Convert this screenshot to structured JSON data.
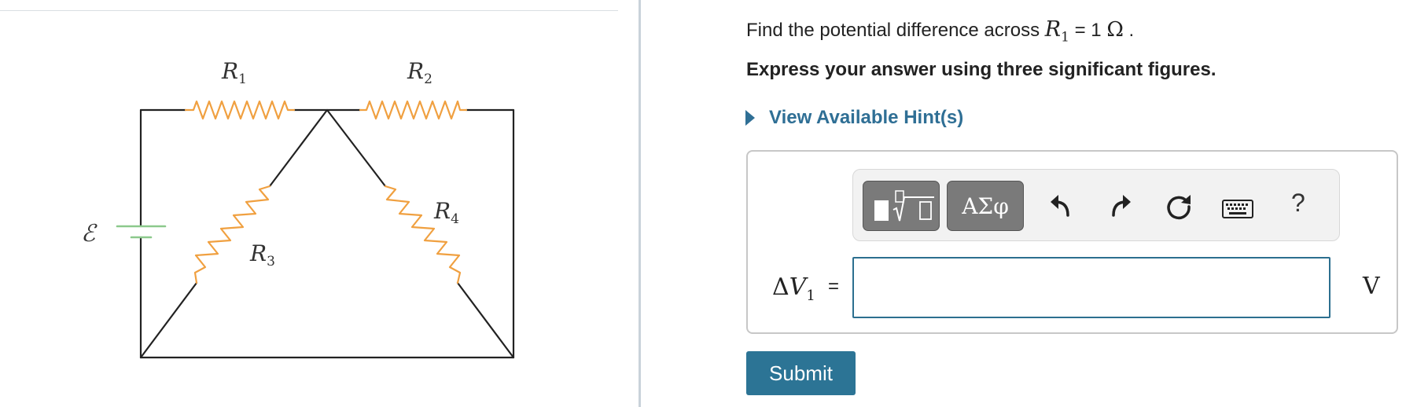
{
  "figure": {
    "emf_label": "ℰ",
    "resistors": [
      {
        "letter": "R",
        "subscript": "1"
      },
      {
        "letter": "R",
        "subscript": "2"
      },
      {
        "letter": "R",
        "subscript": "3"
      },
      {
        "letter": "R",
        "subscript": "4"
      }
    ]
  },
  "question": {
    "prefix": "Find the potential difference across ",
    "resistor_letter": "R",
    "resistor_subscript": "1",
    "equals": " = 1 ",
    "unit_symbol": "Ω",
    "suffix": " ."
  },
  "instruction": "Express your answer using three significant figures.",
  "hint_link": "View Available Hint(s)",
  "toolbar": {
    "templates_icon": "templates-icon",
    "symbols_label": "ΑΣφ",
    "undo_icon": "undo-icon",
    "redo_icon": "redo-icon",
    "reset_icon": "reset-icon",
    "keyboard_icon": "keyboard-icon",
    "help_label": "?"
  },
  "answer": {
    "delta": "Δ",
    "variable": "V",
    "subscript": "1",
    "equals": "=",
    "value": "",
    "unit": "V"
  },
  "submit_label": "Submit",
  "colors": {
    "accent": "#2c7495",
    "hint_text": "#2f6f95",
    "resistor": "#f0a040",
    "battery": "#8cc98c",
    "wire": "#222222"
  }
}
